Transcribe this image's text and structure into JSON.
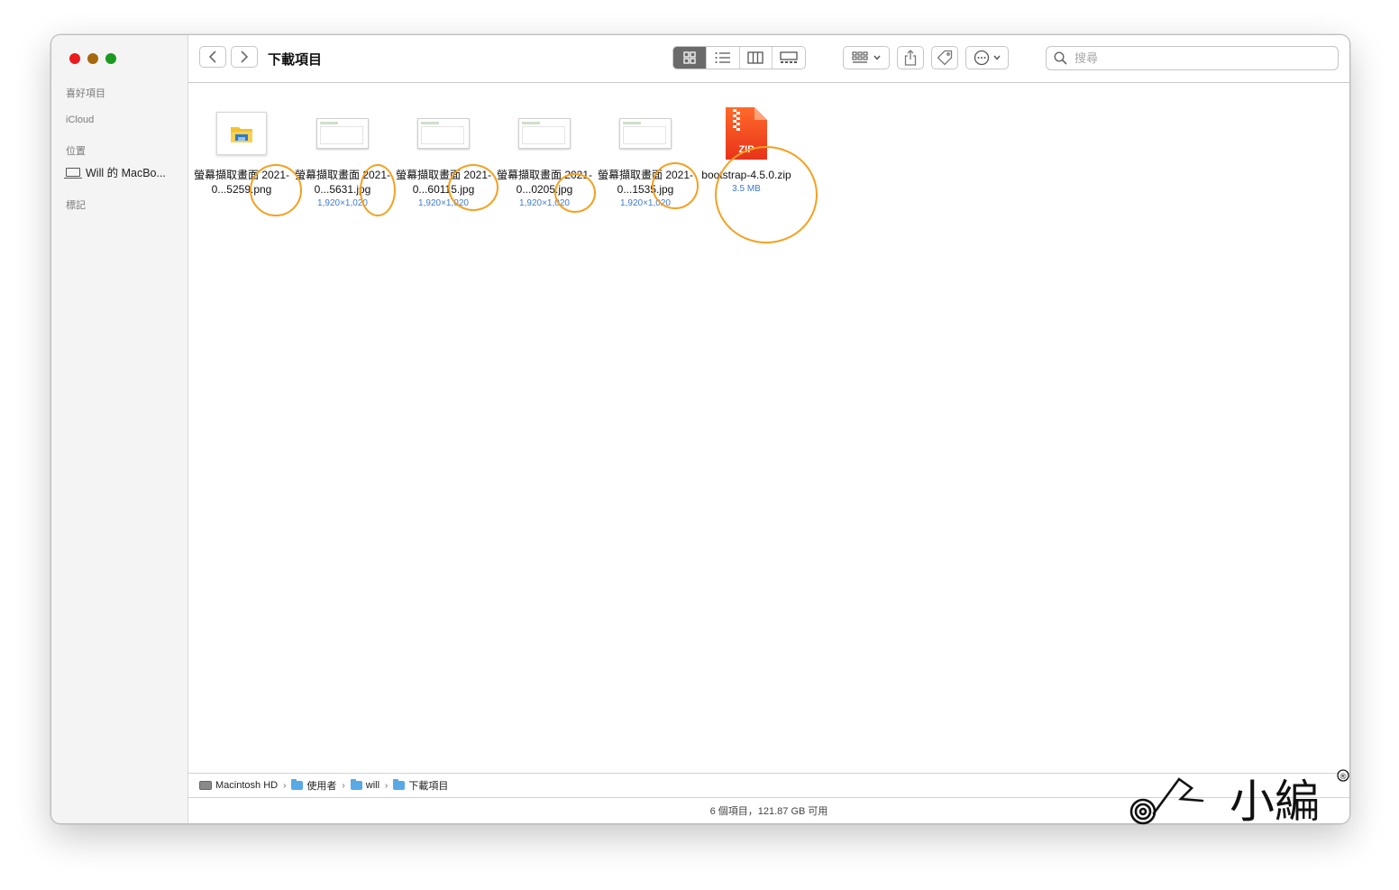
{
  "window": {
    "title": "下載項目",
    "colors": {
      "accent_meta": "#3d7bd1",
      "annotation": "#f5a01f"
    }
  },
  "sidebar": {
    "favorites_title": "喜好項目",
    "icloud_title": "iCloud",
    "locations_title": "位置",
    "locations_items": [
      {
        "label": "Will 的 MacBo...",
        "icon": "laptop-icon"
      }
    ],
    "tags_title": "標記"
  },
  "toolbar": {
    "back_icon": "chevron-left-icon",
    "forward_icon": "chevron-right-icon",
    "view_modes": [
      "icon-view",
      "list-view",
      "column-view",
      "gallery-view"
    ],
    "active_view": "icon-view",
    "search_placeholder": "搜尋"
  },
  "files": [
    {
      "name": "螢幕擷取畫面 2021-0...5259.png",
      "meta": "",
      "type": "png"
    },
    {
      "name": "螢幕擷取畫面 2021-0...5631.jpg",
      "meta": "1,920×1,020",
      "type": "jpg"
    },
    {
      "name": "螢幕擷取畫面 2021-0...60115.jpg",
      "meta": "1,920×1,020",
      "type": "jpg"
    },
    {
      "name": "螢幕擷取畫面 2021-0...0205.jpg",
      "meta": "1,920×1,020",
      "type": "jpg"
    },
    {
      "name": "螢幕擷取畫面 2021-0...1535.jpg",
      "meta": "1,920×1,020",
      "type": "jpg"
    },
    {
      "name": "bootstrap-4.5.0.zip",
      "meta": "3.5 MB",
      "type": "zip",
      "badge": "ZIP"
    }
  ],
  "path": [
    {
      "label": "Macintosh HD",
      "icon": "hard-drive-icon"
    },
    {
      "label": "使用者",
      "icon": "folder-icon"
    },
    {
      "label": "will",
      "icon": "home-folder-icon"
    },
    {
      "label": "下載項目",
      "icon": "folder-icon"
    }
  ],
  "status": "6 個項目，121.87 GB 可用",
  "watermark": {
    "text": "小編",
    "mark": "®"
  }
}
